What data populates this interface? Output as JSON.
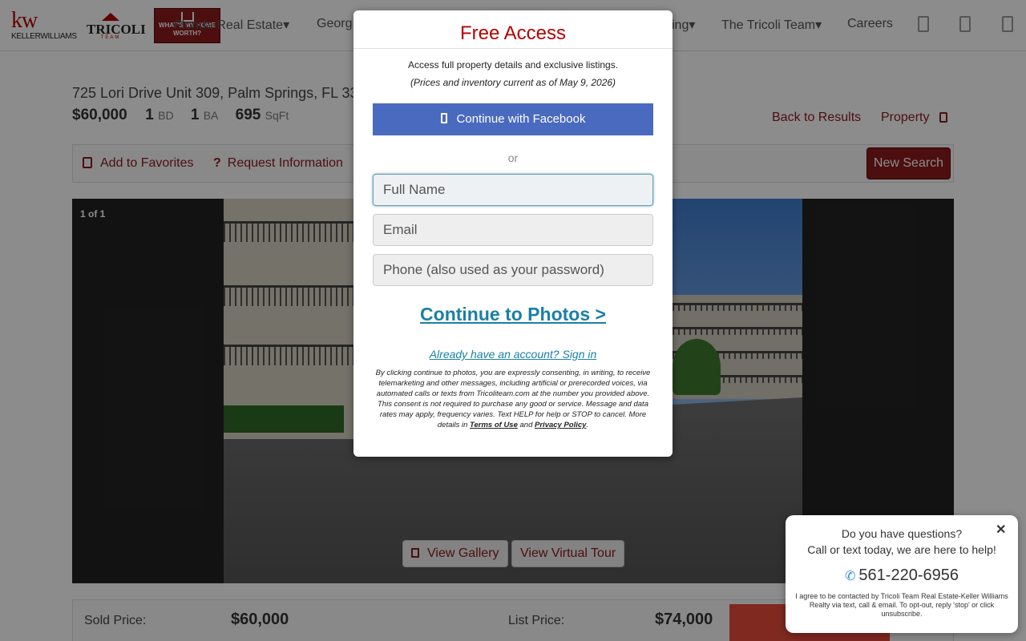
{
  "header": {
    "logo_kw": "kw",
    "logo_kw_name": "KELLERWILLIAMS",
    "logo_tricoli_top": "THE",
    "logo_tricoli": "TRICOLI",
    "logo_tricoli_sub": "TEAM",
    "worth_badge": "WHAT'S MY HOME WORTH?",
    "nav": {
      "florida": "Florida Real Estate▾",
      "georgia": "Georg",
      "listing": "ing▾",
      "team": "The Tricoli Team▾",
      "careers": "Careers"
    },
    "icons": [
      "user-icon",
      "heart-icon",
      "menu-icon"
    ]
  },
  "listing": {
    "address": "725 Lori Drive Unit 309, Palm Springs, FL 33",
    "price": "$60,000",
    "beds": "1",
    "beds_unit": "BD",
    "baths": "1",
    "baths_unit": "BA",
    "sqft": "695",
    "sqft_unit": "SqFt",
    "back_to_results": "Back to Results",
    "property_menu": "Property"
  },
  "toolbar": {
    "add_favorites": "Add to Favorites",
    "request_info_icon": "?",
    "request_info": "Request Information",
    "new_search": "New Search"
  },
  "photos": {
    "count": "1 of 1",
    "view_gallery": "View Gallery",
    "view_tour": "View Virtual Tour"
  },
  "prices": {
    "sold_label": "Sold Price:",
    "sold_value": "$60,000",
    "list_label": "List Price:",
    "list_value": "$74,000"
  },
  "modal": {
    "title": "Free Access",
    "subtitle": "Access full property details and exclusive listings.",
    "note": "(Prices and inventory current as of May 9, 2026)",
    "facebook": "Continue with Facebook",
    "or": "or",
    "fullname_placeholder": "Full Name",
    "email_placeholder": "Email",
    "phone_placeholder": "Phone (also used as your password)",
    "cta": "Continue to Photos >",
    "signin": "Already have an account? Sign in",
    "legal_text": "By clicking continue to photos, you are expressly consenting, in writing, to receive telemarketing and other messages, including artificial or prerecorded voices, via automated calls or texts from Tricoliteam.com at the number you provided above. This consent is not required to purchase any good or service. Message and data rates may apply, frequency varies. Text HELP for help or STOP to cancel. More details in",
    "terms": "Terms of Use",
    "and": "and",
    "privacy": "Privacy Policy",
    "period": "."
  },
  "chat": {
    "close": "✕",
    "question": "Do you have questions?",
    "subtitle": "Call or text today, we are here to help!",
    "phone": "561-220-6956",
    "legal": "I agree to be contacted by Tricoli Team Real Estate-Keller Williams Realty via text, call & email. To opt-out, reply 'stop' or click unsubscribe."
  },
  "colors": {
    "brand_red": "#b40101",
    "button_red": "#8b1a1a",
    "link_blue": "#1b80a4",
    "facebook_blue": "#4a6abf",
    "orange": "#e74c3c"
  }
}
